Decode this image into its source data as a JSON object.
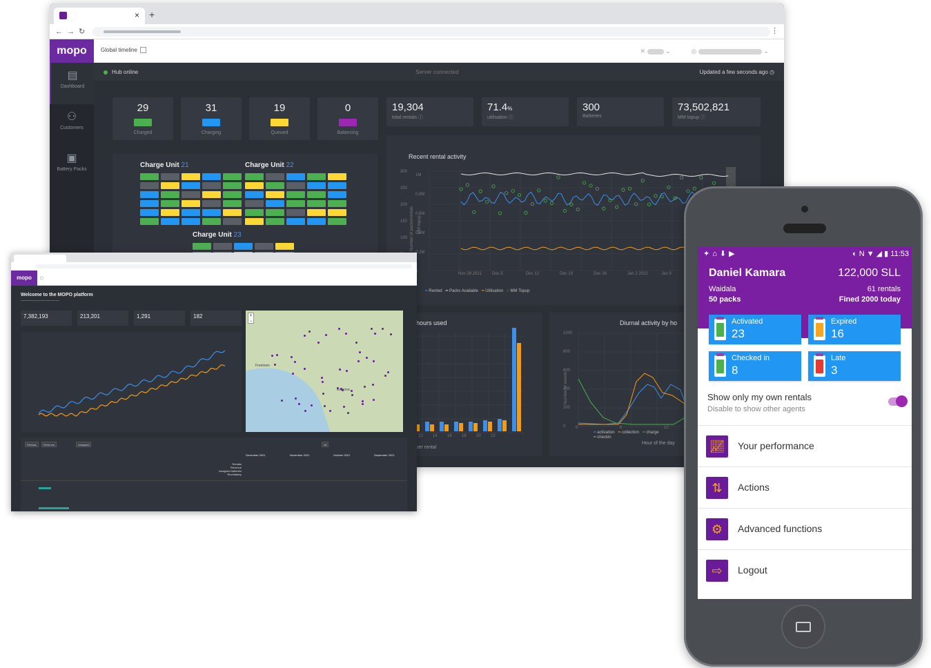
{
  "browser_main": {
    "logo": "mopo",
    "header": {
      "timeline_label": "Global timeline"
    },
    "status": {
      "hub": "Hub online",
      "server": "Server connected",
      "updated": "Updated a few seconds ago"
    },
    "sidebar": [
      {
        "label": "Dashboard",
        "icon": "dashboard-icon",
        "active": true
      },
      {
        "label": "Customers",
        "icon": "customers-icon",
        "active": false
      },
      {
        "label": "Battery Packs",
        "icon": "battery-packs-icon",
        "active": false
      }
    ],
    "kpis": [
      {
        "value": "29",
        "label": "Charged",
        "color": "#4caf50"
      },
      {
        "value": "31",
        "label": "Charging",
        "color": "#2196f3"
      },
      {
        "value": "19",
        "label": "Queued",
        "color": "#fdd835"
      },
      {
        "value": "0",
        "label": "Balancing",
        "color": "#9c27b0"
      }
    ],
    "stats": [
      {
        "value": "19,304",
        "label": "total rentals ⓘ"
      },
      {
        "value": "71.4",
        "unit": "%",
        "label": "utilisation ⓘ"
      },
      {
        "value": "300",
        "label": "Batteries"
      },
      {
        "value": "73,502,821",
        "label": "MM topup ⓘ"
      }
    ],
    "charge_units": [
      {
        "label": "Charge Unit",
        "num": "21"
      },
      {
        "label": "Charge Unit",
        "num": "22"
      },
      {
        "label": "Charge Unit",
        "num": "23"
      }
    ],
    "rental_chart": {
      "title": "Recent rental activity",
      "ylabel_left": "Number of packs/rentals",
      "ylabel_right": "MM topup",
      "y_ticks_left": [
        "300",
        "250",
        "200",
        "150",
        "100",
        "50",
        "0"
      ],
      "y_ticks_right": [
        "1M",
        "0.8M",
        "0.6M",
        "0.4M",
        "0.2M",
        "0"
      ],
      "x_ticks": [
        "Nov 28 2021",
        "Dec 5",
        "Dec 12",
        "Dec 19",
        "Dec 26",
        "Jan 2 2022",
        "Jan 9"
      ],
      "legend": [
        "Rented",
        "Packs Available",
        "Utilisation",
        "MM Topup"
      ]
    },
    "histogram": {
      "title": "gram of hours used",
      "xlabel": "ours used per rental",
      "x_ticks": [
        "8",
        "10",
        "12",
        "14",
        "16",
        "18",
        "20",
        "22"
      ]
    },
    "diurnal": {
      "title": "Diurnal activity by ho",
      "ylabel": "Number of events",
      "y_ticks": [
        "1000",
        "800",
        "600",
        "400",
        "200",
        "0"
      ],
      "x_ticks": [
        "0",
        "6",
        "12"
      ],
      "xlabel": "Hour of the day",
      "legend": [
        "activation",
        "collection",
        "charge",
        "checkin"
      ]
    }
  },
  "browser_second": {
    "logo": "mopo",
    "welcome": "Welcome to the MOPO platform",
    "kpis": [
      "7,382,193",
      "213,201",
      "1,291",
      "182"
    ],
    "map_places": [
      "Freetown",
      "Kenema"
    ],
    "table_months": [
      "December 2021",
      "November 2021",
      "October 2021",
      "September 2021"
    ],
    "row_labels": [
      "Rentals",
      "Revenue",
      "Assigned batteries",
      "Rev/battery"
    ]
  },
  "phone": {
    "time": "11:53",
    "user": "Daniel Kamara",
    "balance": "122,000 SLL",
    "location": "Waidala",
    "packs": "50 packs",
    "rentals": "61 rentals",
    "fined": "Fined 2000 today",
    "tiles": [
      {
        "label": "Activated",
        "value": "23",
        "color": "#4caf50"
      },
      {
        "label": "Expired",
        "value": "16",
        "color": "#f5a623"
      },
      {
        "label": "Checked in",
        "value": "8",
        "color": "#4caf50"
      },
      {
        "label": "Late",
        "value": "3",
        "color": "#e53935"
      }
    ],
    "toggle": {
      "title": "Show only my own rentals",
      "subtitle": "Disable to show other agents",
      "on": true
    },
    "menu": [
      {
        "label": "Your performance",
        "icon": "chart-icon"
      },
      {
        "label": "Actions",
        "icon": "signpost-icon"
      },
      {
        "label": "Advanced functions",
        "icon": "gear-icon"
      },
      {
        "label": "Logout",
        "icon": "logout-icon"
      }
    ],
    "accent": "#7b1fa2"
  }
}
